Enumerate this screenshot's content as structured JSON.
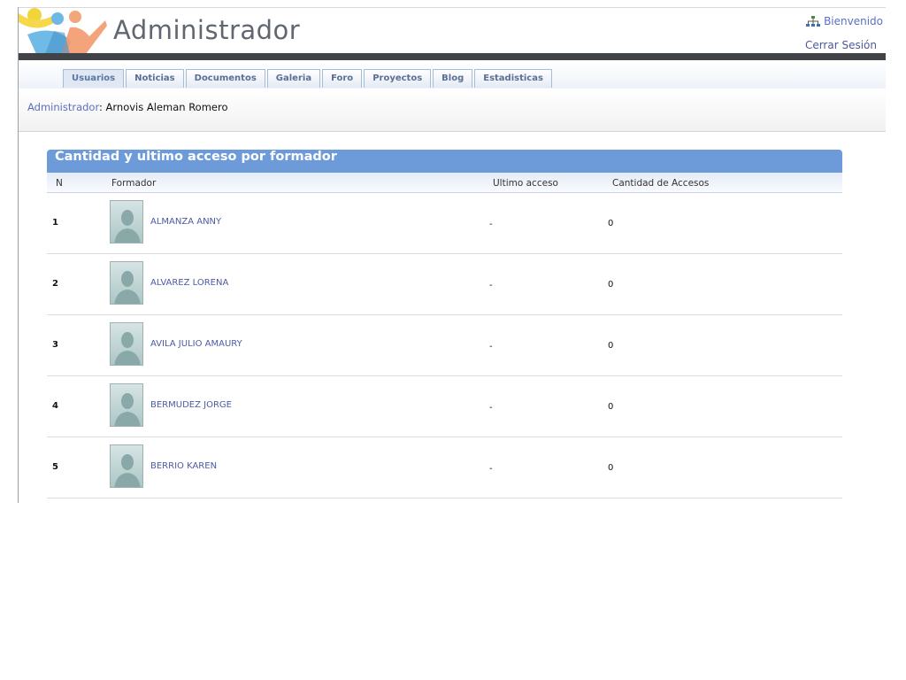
{
  "header": {
    "title": "Administrador",
    "welcome": "Bienvenido",
    "logout": "Cerrar Sesión"
  },
  "tabs": [
    {
      "label": "Usuarios",
      "active": true
    },
    {
      "label": "Noticias"
    },
    {
      "label": "Documentos"
    },
    {
      "label": "Galeria"
    },
    {
      "label": "Foro"
    },
    {
      "label": "Proyectos"
    },
    {
      "label": "Blog"
    },
    {
      "label": "Estadisticas"
    }
  ],
  "breadcrumb": {
    "link": "Administrador",
    "separator": ":",
    "user": " Arnovis Aleman Romero"
  },
  "panel": {
    "title": "Cantidad y ultimo acceso por formador",
    "columns": {
      "n": "N",
      "formador": "Formador",
      "ultimo": "Ultimo acceso",
      "cantidad": "Cantidad de Accesos"
    },
    "rows": [
      {
        "n": "1",
        "name": "ALMANZA ANNY",
        "last": "-",
        "count": "0"
      },
      {
        "n": "2",
        "name": "ALVAREZ LORENA",
        "last": "-",
        "count": "0"
      },
      {
        "n": "3",
        "name": "AVILA JULIO AMAURY",
        "last": "-",
        "count": "0"
      },
      {
        "n": "4",
        "name": "BERMUDEZ JORGE",
        "last": "-",
        "count": "0"
      },
      {
        "n": "5",
        "name": "BERRIO KAREN",
        "last": "-",
        "count": "0"
      }
    ]
  },
  "colors": {
    "panel_header": "#6d9ad9",
    "link": "#4d5aa3",
    "dark_bar": "#404448"
  }
}
